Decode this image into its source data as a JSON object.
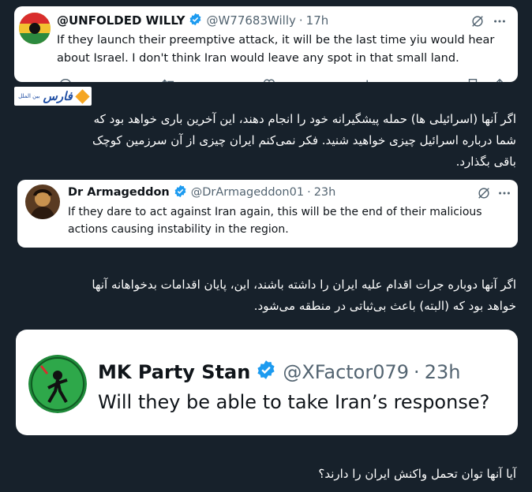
{
  "tweet1": {
    "name": "@UNFOLDED WILLY",
    "handle": "@W77683Willy",
    "time": "17h",
    "line1": "If they launch their preemptive attack, it will be the last time yiu would hear",
    "line2": "about Israel. I don't think Iran would leave any spot in that small land."
  },
  "logo": {
    "text": "فارس",
    "sub": "بین الملل"
  },
  "trans1": {
    "line1": "اگر آنها (اسرائیلی ها) حمله پیشگیرانه خود را انجام دهند، این آخرین باری خواهد بود که",
    "line2": "شما درباره اسرائیل چیزی خواهید شنید. فکر نمی‌کنم ایران چیزی از آن سرزمین کوچک",
    "line3": "باقی بگذارد."
  },
  "tweet2": {
    "name": "Dr Armageddon",
    "handle": "@DrArmageddon01",
    "time": "23h",
    "line1": "If they dare to act against Iran again, this will be the end of their malicious",
    "line2": "actions causing instability in the region."
  },
  "trans2": {
    "line1": "اگر آنها دوباره جرات اقدام علیه ایران را داشته باشند، این، پایان اقدامات بدخواهانه آنها",
    "line2": "خواهد بود که (البته) باعث بی‌ثباتی در منطقه می‌شود."
  },
  "tweet3": {
    "name": "MK Party Stan",
    "handle": "@XFactor079",
    "time": "23h",
    "text": "Will they be able to take Iran’s response?"
  },
  "trans3": {
    "line1": "آیا آنها توان تحمل واکنش ایران را دارند؟"
  },
  "colors": {
    "background": "#17212b",
    "verified": "#1d9bf0",
    "logo_accent": "#f5a623",
    "logo_blue": "#1f4ea3"
  },
  "icons": [
    "verified-badge-icon",
    "grok-icon",
    "more-icon",
    "reply-icon",
    "retweet-icon",
    "like-icon",
    "views-icon",
    "bookmark-icon",
    "share-icon"
  ]
}
